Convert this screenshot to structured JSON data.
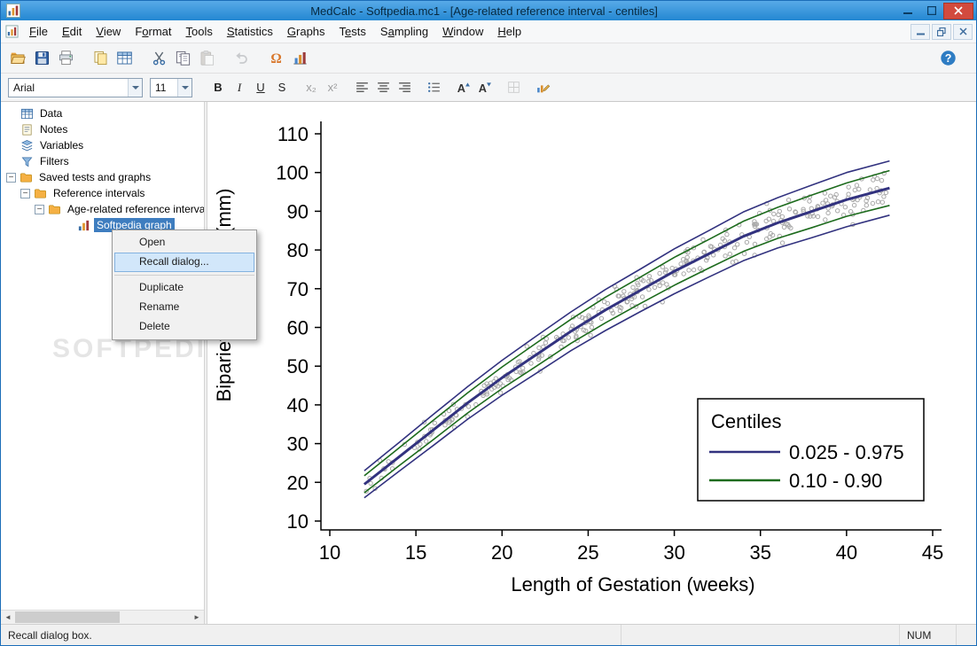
{
  "window": {
    "title": "MedCalc - Softpedia.mc1 - [Age-related reference interval - centiles]"
  },
  "menu_bar": {
    "items": [
      {
        "label": "File",
        "underline": 0
      },
      {
        "label": "Edit",
        "underline": 0
      },
      {
        "label": "View",
        "underline": 0
      },
      {
        "label": "Format",
        "underline": 1
      },
      {
        "label": "Tools",
        "underline": 0
      },
      {
        "label": "Statistics",
        "underline": 0
      },
      {
        "label": "Graphs",
        "underline": 0
      },
      {
        "label": "Tests",
        "underline": 1
      },
      {
        "label": "Sampling",
        "underline": 1
      },
      {
        "label": "Window",
        "underline": 0
      },
      {
        "label": "Help",
        "underline": 0
      }
    ]
  },
  "toolbar": {
    "buttons": [
      {
        "name": "open-file-button",
        "icon": "folder-open-icon",
        "group": 1
      },
      {
        "name": "save-button",
        "icon": "save-icon",
        "group": 1
      },
      {
        "name": "print-button",
        "icon": "print-icon",
        "group": 1
      },
      {
        "name": "duplicate-document-button",
        "icon": "duplicate-icon",
        "group": 2
      },
      {
        "name": "spreadsheet-button",
        "icon": "table-icon",
        "group": 2
      },
      {
        "name": "cut-button",
        "icon": "scissors-icon",
        "group": 3
      },
      {
        "name": "copy-button",
        "icon": "copy-icon",
        "group": 3
      },
      {
        "name": "paste-button",
        "icon": "paste-icon",
        "group": 3,
        "disabled": true
      },
      {
        "name": "undo-button",
        "icon": "undo-icon",
        "group": 4,
        "disabled": true
      },
      {
        "name": "insert-symbol-button",
        "icon": "omega-icon",
        "group": 5
      },
      {
        "name": "graph-wizard-button",
        "icon": "graph-edit-icon",
        "group": 5
      }
    ]
  },
  "format_bar": {
    "font_name": "Arial",
    "font_size": "11",
    "buttons": [
      {
        "name": "bold-button",
        "glyph": "B",
        "cls": "fb-b",
        "group": 1
      },
      {
        "name": "italic-button",
        "glyph": "I",
        "cls": "fb-i",
        "group": 1
      },
      {
        "name": "underline-button",
        "glyph": "U",
        "cls": "fb-u",
        "group": 1
      },
      {
        "name": "strikethrough-button",
        "glyph": "S",
        "cls": "",
        "group": 1
      },
      {
        "name": "subscript-button",
        "glyph": "x₂",
        "cls": "",
        "group": 2,
        "disabled": true
      },
      {
        "name": "superscript-button",
        "glyph": "x²",
        "cls": "",
        "group": 2,
        "disabled": true
      },
      {
        "name": "align-left-button",
        "icon": "align-left-icon",
        "group": 3
      },
      {
        "name": "align-center-button",
        "icon": "align-center-icon",
        "group": 3
      },
      {
        "name": "align-right-button",
        "icon": "align-right-icon",
        "group": 3
      },
      {
        "name": "list-button",
        "icon": "list-icon",
        "group": 4
      },
      {
        "name": "increase-font-button",
        "icon": "font-increase-icon",
        "group": 5
      },
      {
        "name": "decrease-font-button",
        "icon": "font-decrease-icon",
        "group": 5
      },
      {
        "name": "cell-format-button",
        "icon": "cell-format-icon",
        "group": 6,
        "disabled": true
      },
      {
        "name": "graph-options-button",
        "icon": "graph-options-icon",
        "group": 7
      }
    ]
  },
  "tree": {
    "items": [
      {
        "label": "Data",
        "icon": "data-table-icon",
        "indent": 22
      },
      {
        "label": "Notes",
        "icon": "notes-icon",
        "indent": 22
      },
      {
        "label": "Variables",
        "icon": "variables-icon",
        "indent": 22
      },
      {
        "label": "Filters",
        "icon": "filter-icon",
        "indent": 22
      },
      {
        "label": "Saved tests and graphs",
        "icon": "folder-icon",
        "indent": 6,
        "expander": "−"
      },
      {
        "label": "Reference intervals",
        "icon": "folder-icon",
        "indent": 22,
        "expander": "−"
      },
      {
        "label": "Age-related reference interval",
        "icon": "folder-icon",
        "indent": 38,
        "expander": "−"
      },
      {
        "label": "Softpedia graph",
        "icon": "bar-graph-icon",
        "indent": 86,
        "selected": true
      }
    ]
  },
  "context_menu": {
    "items": [
      {
        "label": "Open"
      },
      {
        "label": "Recall dialog...",
        "highlighted": true
      },
      {
        "separator": true
      },
      {
        "label": "Duplicate"
      },
      {
        "label": "Rename"
      },
      {
        "label": "Delete"
      }
    ]
  },
  "watermark": "SOFTPEDIA",
  "status_bar": {
    "message": "Recall dialog box.",
    "num_lock": "NUM"
  },
  "chart_data": {
    "type": "line",
    "title": "",
    "xlabel": "Length of Gestation (weeks)",
    "ylabel": "Biparietal diameter (mm)",
    "xlim": [
      10,
      45
    ],
    "ylim": [
      10,
      110
    ],
    "xticks": [
      10,
      15,
      20,
      25,
      30,
      35,
      40,
      45
    ],
    "yticks": [
      10,
      20,
      30,
      40,
      50,
      60,
      70,
      80,
      90,
      100,
      110
    ],
    "grid": false,
    "legend": {
      "title": "Centiles",
      "position": "lower-right",
      "entries": [
        {
          "label": "0.025 - 0.975",
          "color": "#32327f"
        },
        {
          "label": "0.10 - 0.90",
          "color": "#1d6b1d"
        }
      ]
    },
    "x": [
      12,
      14,
      16,
      18,
      20,
      22,
      24,
      26,
      28,
      30,
      32,
      34,
      36,
      38,
      40,
      42.5
    ],
    "series": [
      {
        "name": "median",
        "color": "#32327f",
        "width": 3,
        "values": [
          19.5,
          26.5,
          33.5,
          40.5,
          47,
          53,
          59,
          64.5,
          69.5,
          74.5,
          79,
          83.5,
          87,
          90,
          93,
          96
        ]
      },
      {
        "name": "centile 0.975",
        "color": "#32327f",
        "width": 1.6,
        "values": [
          23,
          30.2,
          37.5,
          44.7,
          51.5,
          57.8,
          64,
          69.8,
          75,
          80.3,
          85,
          89.8,
          93.5,
          96.8,
          100,
          103
        ]
      },
      {
        "name": "centile 0.025",
        "color": "#32327f",
        "width": 1.6,
        "values": [
          16,
          22.8,
          29.5,
          36.3,
          42.5,
          48.2,
          54,
          59.2,
          64,
          68.7,
          73,
          77.2,
          80.5,
          83.2,
          86,
          89
        ]
      },
      {
        "name": "centile 0.90",
        "color": "#1d6b1d",
        "width": 1.6,
        "values": [
          21.7,
          28.8,
          36,
          43.1,
          49.8,
          56,
          62.1,
          67.8,
          72.9,
          78.1,
          82.7,
          87.4,
          91,
          94.2,
          97.3,
          100.5
        ]
      },
      {
        "name": "centile 0.10",
        "color": "#1d6b1d",
        "width": 1.6,
        "values": [
          17.3,
          24.2,
          31,
          37.9,
          44.2,
          50,
          55.9,
          61.2,
          66.1,
          70.9,
          75.3,
          79.6,
          83,
          85.8,
          88.7,
          91.5
        ]
      }
    ],
    "scatter": {
      "count": 330,
      "seed": 11,
      "marker": "circle-outline",
      "color": "#9a9a9a"
    }
  }
}
